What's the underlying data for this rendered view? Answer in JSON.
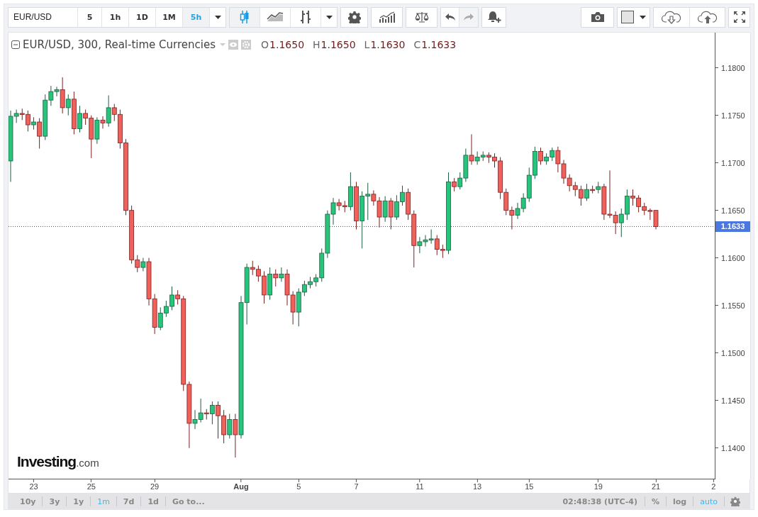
{
  "toolbar": {
    "symbol": "EUR/USD",
    "intervals": [
      {
        "label": "5",
        "selected": false
      },
      {
        "label": "1h",
        "selected": false
      },
      {
        "label": "1D",
        "selected": false
      },
      {
        "label": "1M",
        "selected": false
      },
      {
        "label": "5h",
        "selected": true
      }
    ],
    "chart_types": [
      {
        "kind": "candles",
        "selected": true
      },
      {
        "kind": "area",
        "selected": false
      },
      {
        "kind": "bars",
        "selected": false
      }
    ],
    "undo": {
      "disabled": false
    },
    "redo": {
      "disabled": true
    }
  },
  "legend": {
    "title": "EUR/USD, 300, Real-time Currencies",
    "ohlc": [
      {
        "label": "O",
        "value": "1.1650"
      },
      {
        "label": "H",
        "value": "1.1650"
      },
      {
        "label": "L",
        "value": "1.1630"
      },
      {
        "label": "C",
        "value": "1.1633"
      }
    ]
  },
  "chart": {
    "chart_data": {
      "type": "candlestick",
      "ylim": [
        1.1367,
        1.1837
      ],
      "yticks": [
        {
          "value": 1.18,
          "label": "1.1800"
        },
        {
          "value": 1.175,
          "label": "1.1750"
        },
        {
          "value": 1.17,
          "label": "1.1700"
        },
        {
          "value": 1.165,
          "label": "1.1650"
        },
        {
          "value": 1.16,
          "label": "1.1600"
        },
        {
          "value": 1.155,
          "label": "1.1550"
        },
        {
          "value": 1.15,
          "label": "1.1500"
        },
        {
          "value": 1.145,
          "label": "1.1450"
        },
        {
          "value": 1.14,
          "label": "1.1400"
        }
      ],
      "categories": [
        null,
        null,
        null,
        null,
        "23",
        null,
        null,
        null,
        null,
        null,
        null,
        null,
        null,
        null,
        "25",
        null,
        null,
        null,
        null,
        null,
        null,
        null,
        null,
        null,
        null,
        "29",
        null,
        null,
        null,
        null,
        null,
        null,
        null,
        null,
        null,
        null,
        null,
        null,
        null,
        null,
        "Aug",
        null,
        null,
        null,
        null,
        null,
        null,
        null,
        null,
        null,
        "5",
        null,
        null,
        null,
        null,
        null,
        null,
        null,
        null,
        null,
        "7",
        null,
        null,
        null,
        null,
        null,
        null,
        null,
        null,
        null,
        null,
        "11",
        null,
        null,
        null,
        null,
        null,
        null,
        null,
        null,
        null,
        "13",
        null,
        null,
        null,
        null,
        null,
        null,
        null,
        null,
        "15",
        null,
        null,
        null,
        null,
        null,
        null,
        null,
        null,
        null,
        null,
        null,
        "19",
        null,
        null,
        null,
        null,
        null,
        null,
        null,
        null,
        null,
        "21",
        null,
        null,
        null,
        null,
        null,
        null,
        null,
        null,
        null,
        "2"
      ],
      "ohlc": [
        [
          1.1702,
          1.1755,
          1.168,
          1.1749
        ],
        [
          1.1749,
          1.1756,
          1.1742,
          1.1752
        ],
        [
          1.1752,
          1.1757,
          1.1745,
          1.1751
        ],
        [
          1.1751,
          1.1755,
          1.1733,
          1.174
        ],
        [
          1.174,
          1.1748,
          1.1735,
          1.1743
        ],
        [
          1.1743,
          1.1747,
          1.1715,
          1.1728
        ],
        [
          1.1728,
          1.1772,
          1.1724,
          1.1766
        ],
        [
          1.1766,
          1.1781,
          1.176,
          1.1775
        ],
        [
          1.1775,
          1.178,
          1.177,
          1.1777
        ],
        [
          1.1777,
          1.179,
          1.1752,
          1.1758
        ],
        [
          1.1758,
          1.1772,
          1.175,
          1.1767
        ],
        [
          1.1767,
          1.1775,
          1.173,
          1.1736
        ],
        [
          1.1736,
          1.176,
          1.1732,
          1.1752
        ],
        [
          1.1752,
          1.1756,
          1.174,
          1.1747
        ],
        [
          1.1747,
          1.175,
          1.1705,
          1.1725
        ],
        [
          1.1725,
          1.1748,
          1.172,
          1.1745
        ],
        [
          1.1745,
          1.1749,
          1.1736,
          1.1742
        ],
        [
          1.1742,
          1.1771,
          1.1738,
          1.1758
        ],
        [
          1.1758,
          1.1762,
          1.1744,
          1.1751
        ],
        [
          1.1751,
          1.1756,
          1.1715,
          1.1721
        ],
        [
          1.1721,
          1.1725,
          1.1645,
          1.165
        ],
        [
          1.165,
          1.1655,
          1.1594,
          1.1598
        ],
        [
          1.1598,
          1.1603,
          1.1585,
          1.159
        ],
        [
          1.159,
          1.16,
          1.1586,
          1.1596
        ],
        [
          1.1596,
          1.16,
          1.155,
          1.1557
        ],
        [
          1.1557,
          1.1562,
          1.152,
          1.1527
        ],
        [
          1.1527,
          1.1548,
          1.1524,
          1.1542
        ],
        [
          1.1542,
          1.1555,
          1.1538,
          1.1549
        ],
        [
          1.1549,
          1.157,
          1.1545,
          1.1561
        ],
        [
          1.1561,
          1.1566,
          1.1551,
          1.1557
        ],
        [
          1.1557,
          1.156,
          1.146,
          1.1467
        ],
        [
          1.1467,
          1.147,
          1.14,
          1.1426
        ],
        [
          1.1426,
          1.144,
          1.142,
          1.143
        ],
        [
          1.143,
          1.1452,
          1.1427,
          1.1437
        ],
        [
          1.1437,
          1.1441,
          1.143,
          1.1436
        ],
        [
          1.1436,
          1.1449,
          1.1425,
          1.1445
        ],
        [
          1.1445,
          1.1449,
          1.141,
          1.1434
        ],
        [
          1.1434,
          1.144,
          1.1405,
          1.1414
        ],
        [
          1.1414,
          1.1436,
          1.141,
          1.143
        ],
        [
          1.143,
          1.1436,
          1.139,
          1.1414
        ],
        [
          1.1414,
          1.156,
          1.141,
          1.1553
        ],
        [
          1.1553,
          1.1594,
          1.153,
          1.159
        ],
        [
          1.159,
          1.1597,
          1.1582,
          1.1588
        ],
        [
          1.1588,
          1.1592,
          1.1575,
          1.1581
        ],
        [
          1.1581,
          1.1586,
          1.1552,
          1.1561
        ],
        [
          1.1561,
          1.159,
          1.1556,
          1.1583
        ],
        [
          1.1583,
          1.1588,
          1.157,
          1.1579
        ],
        [
          1.1579,
          1.159,
          1.1575,
          1.1583
        ],
        [
          1.1583,
          1.1588,
          1.155,
          1.1561
        ],
        [
          1.1561,
          1.1565,
          1.153,
          1.1543
        ],
        [
          1.1543,
          1.1568,
          1.1528,
          1.1564
        ],
        [
          1.1564,
          1.1576,
          1.156,
          1.1572
        ],
        [
          1.1572,
          1.158,
          1.1568,
          1.1575
        ],
        [
          1.1575,
          1.1583,
          1.157,
          1.1579
        ],
        [
          1.1579,
          1.161,
          1.1575,
          1.1605
        ],
        [
          1.1605,
          1.165,
          1.16,
          1.1646
        ],
        [
          1.1646,
          1.1663,
          1.1635,
          1.1658
        ],
        [
          1.1658,
          1.1662,
          1.165,
          1.1655
        ],
        [
          1.1655,
          1.166,
          1.1648,
          1.1654
        ],
        [
          1.1654,
          1.169,
          1.165,
          1.1675
        ],
        [
          1.1675,
          1.168,
          1.163,
          1.1639
        ],
        [
          1.1639,
          1.167,
          1.161,
          1.1665
        ],
        [
          1.1665,
          1.1679,
          1.164,
          1.1667
        ],
        [
          1.1667,
          1.1671,
          1.1655,
          1.166
        ],
        [
          1.166,
          1.1664,
          1.1632,
          1.1643
        ],
        [
          1.1643,
          1.1665,
          1.1638,
          1.166
        ],
        [
          1.166,
          1.1663,
          1.163,
          1.1643
        ],
        [
          1.1643,
          1.1666,
          1.164,
          1.1659
        ],
        [
          1.1659,
          1.1676,
          1.1655,
          1.1669
        ],
        [
          1.1669,
          1.1673,
          1.164,
          1.1646
        ],
        [
          1.1646,
          1.165,
          1.159,
          1.1613
        ],
        [
          1.1613,
          1.1622,
          1.1605,
          1.1617
        ],
        [
          1.1617,
          1.1624,
          1.1612,
          1.1619
        ],
        [
          1.1619,
          1.163,
          1.1615,
          1.162
        ],
        [
          1.162,
          1.1624,
          1.1603,
          1.1609
        ],
        [
          1.1609,
          1.1614,
          1.16,
          1.1608
        ],
        [
          1.1608,
          1.169,
          1.1604,
          1.168
        ],
        [
          1.168,
          1.1684,
          1.167,
          1.1675
        ],
        [
          1.1675,
          1.169,
          1.1672,
          1.1684
        ],
        [
          1.1684,
          1.1715,
          1.168,
          1.1708
        ],
        [
          1.1708,
          1.173,
          1.1698,
          1.1702
        ],
        [
          1.1702,
          1.1712,
          1.1698,
          1.1706
        ],
        [
          1.1706,
          1.1712,
          1.1702,
          1.1708
        ],
        [
          1.1708,
          1.1711,
          1.17,
          1.1706
        ],
        [
          1.1706,
          1.171,
          1.1695,
          1.1702
        ],
        [
          1.1702,
          1.1706,
          1.1662,
          1.1669
        ],
        [
          1.1669,
          1.1673,
          1.1645,
          1.165
        ],
        [
          1.165,
          1.1654,
          1.163,
          1.1645
        ],
        [
          1.1645,
          1.1658,
          1.1641,
          1.1652
        ],
        [
          1.1652,
          1.1668,
          1.1648,
          1.1663
        ],
        [
          1.1663,
          1.1695,
          1.1659,
          1.1687
        ],
        [
          1.1687,
          1.1717,
          1.1683,
          1.1712
        ],
        [
          1.1712,
          1.1716,
          1.1698,
          1.1702
        ],
        [
          1.1702,
          1.171,
          1.1698,
          1.1706
        ],
        [
          1.1706,
          1.1716,
          1.1702,
          1.1713
        ],
        [
          1.1713,
          1.1717,
          1.169,
          1.1699
        ],
        [
          1.1699,
          1.1703,
          1.1678,
          1.1684
        ],
        [
          1.1684,
          1.1688,
          1.167,
          1.1676
        ],
        [
          1.1676,
          1.168,
          1.1665,
          1.1672
        ],
        [
          1.1672,
          1.1676,
          1.1655,
          1.1663
        ],
        [
          1.1663,
          1.1678,
          1.166,
          1.1672
        ],
        [
          1.1672,
          1.1676,
          1.1668,
          1.1672
        ],
        [
          1.1672,
          1.168,
          1.1668,
          1.1675
        ],
        [
          1.1675,
          1.1678,
          1.164,
          1.1646
        ],
        [
          1.1646,
          1.1692,
          1.1642,
          1.1645
        ],
        [
          1.1645,
          1.1649,
          1.1625,
          1.1637
        ],
        [
          1.1637,
          1.1652,
          1.1622,
          1.1646
        ],
        [
          1.1646,
          1.1672,
          1.164,
          1.1665
        ],
        [
          1.1665,
          1.1672,
          1.1655,
          1.1663
        ],
        [
          1.1663,
          1.1666,
          1.1648,
          1.1654
        ],
        [
          1.1654,
          1.1658,
          1.1645,
          1.165
        ],
        [
          1.165,
          1.1652,
          1.164,
          1.165
        ],
        [
          1.165,
          1.165,
          1.163,
          1.1633
        ],
        null,
        null,
        null,
        null,
        null,
        null,
        null,
        null,
        null,
        null
      ],
      "ref_lines": [
        {
          "axis": "y",
          "value": 1.1633
        }
      ]
    },
    "last_price": "1.1633",
    "time_label_bold": [
      false,
      false,
      false,
      true,
      false,
      false,
      false,
      false,
      false,
      false,
      false,
      false
    ]
  },
  "logo": {
    "name": "Investing",
    "suffix": ".com"
  },
  "bottom_bar": {
    "ranges": [
      {
        "label": "10y",
        "selected": false
      },
      {
        "label": "3y",
        "selected": false
      },
      {
        "label": "1y",
        "selected": false
      },
      {
        "label": "1m",
        "selected": true
      },
      {
        "label": "7d",
        "selected": false
      },
      {
        "label": "1d",
        "selected": false
      }
    ],
    "goto": "Go to...",
    "time": "02:48:38 (UTC-4)",
    "scale_options": [
      {
        "label": "%",
        "selected": false
      },
      {
        "label": "log",
        "selected": false
      },
      {
        "label": "auto",
        "selected": true
      }
    ]
  }
}
